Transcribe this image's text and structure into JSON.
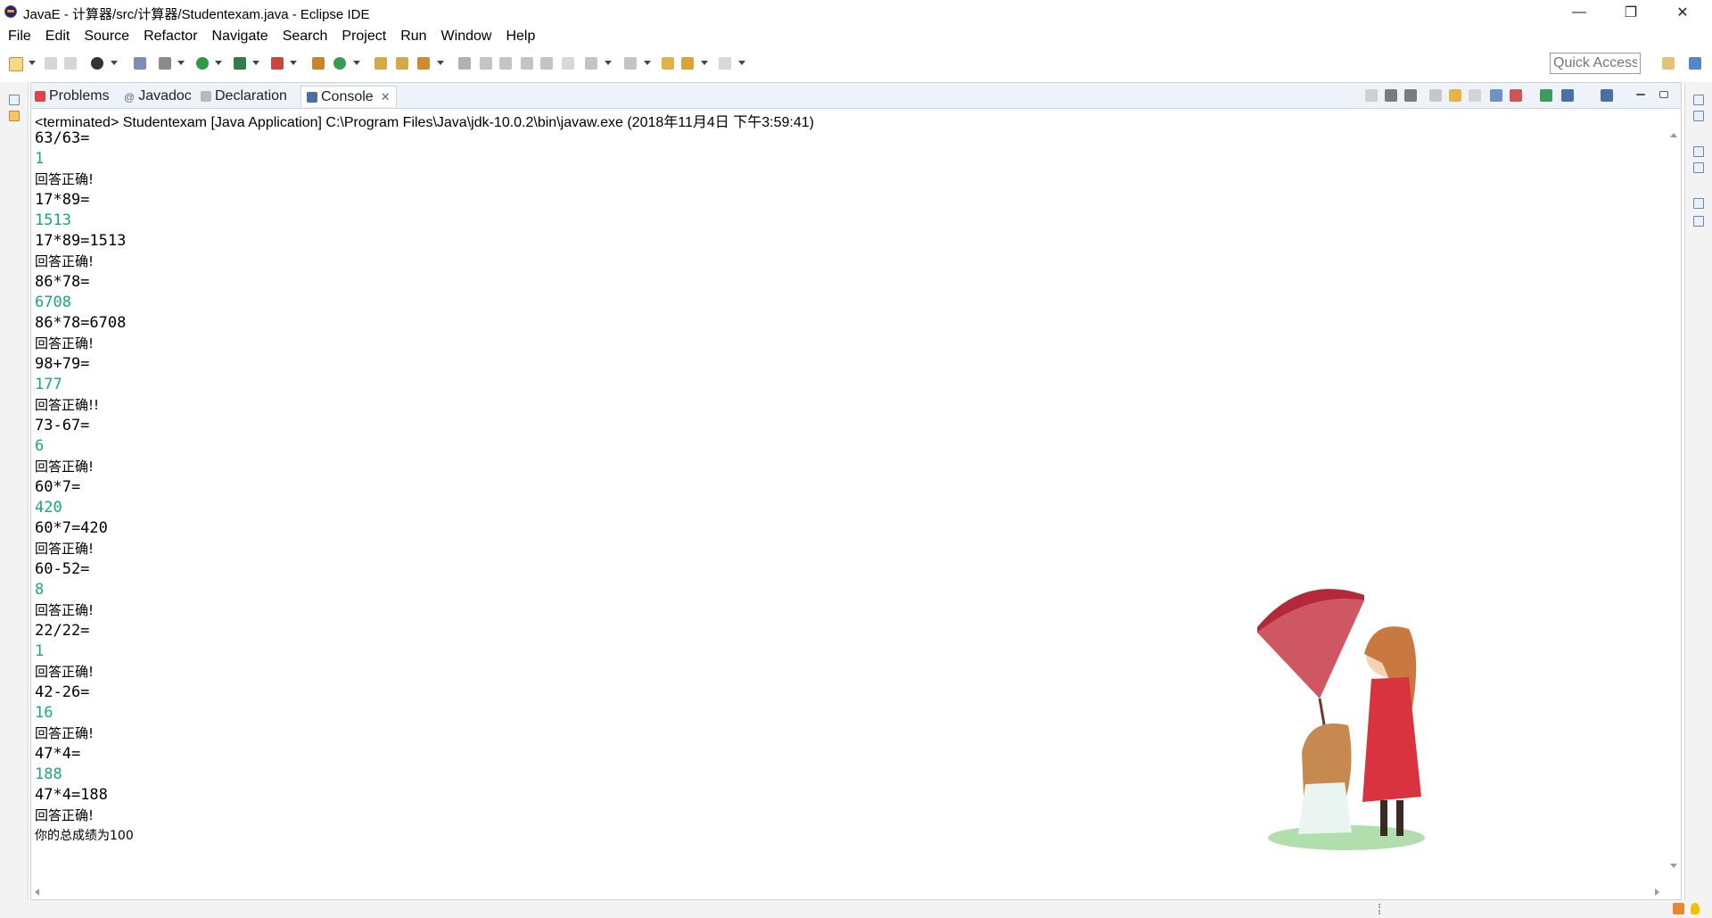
{
  "window": {
    "title": "JavaE - 计算器/src/计算器/Studentexam.java - Eclipse IDE",
    "minimize_glyph": "—",
    "restore_glyph": "❐",
    "close_glyph": "✕"
  },
  "menu": [
    "File",
    "Edit",
    "Source",
    "Refactor",
    "Navigate",
    "Search",
    "Project",
    "Run",
    "Window",
    "Help"
  ],
  "toolbar": {
    "quick_access_placeholder": "Quick Access"
  },
  "tabs": [
    {
      "label": "Problems",
      "icon": "problems-icon"
    },
    {
      "label": "Javadoc",
      "icon": "javadoc-icon"
    },
    {
      "label": "Declaration",
      "icon": "declaration-icon"
    },
    {
      "label": "Console",
      "icon": "console-icon",
      "active": true
    }
  ],
  "tab_close_glyph": "✕",
  "console": {
    "header": "<terminated> Studentexam [Java Application] C:\\Program Files\\Java\\jdk-10.0.2\\bin\\javaw.exe (2018年11月4日 下午3:59:41)",
    "lines": [
      {
        "text": "63/63=",
        "kind": "prompt"
      },
      {
        "text": "1",
        "kind": "input"
      },
      {
        "text": "回答正确!",
        "kind": "msg"
      },
      {
        "text": "17*89=",
        "kind": "prompt"
      },
      {
        "text": "1513",
        "kind": "input"
      },
      {
        "text": "17*89=1513",
        "kind": "prompt"
      },
      {
        "text": "回答正确!",
        "kind": "msg"
      },
      {
        "text": "86*78=",
        "kind": "prompt"
      },
      {
        "text": "6708",
        "kind": "input"
      },
      {
        "text": "86*78=6708",
        "kind": "prompt"
      },
      {
        "text": "回答正确!",
        "kind": "msg"
      },
      {
        "text": "98+79=",
        "kind": "prompt"
      },
      {
        "text": "177",
        "kind": "input"
      },
      {
        "text": "回答正确!!",
        "kind": "msg"
      },
      {
        "text": "73-67=",
        "kind": "prompt"
      },
      {
        "text": "6",
        "kind": "input"
      },
      {
        "text": "回答正确!",
        "kind": "msg"
      },
      {
        "text": "60*7=",
        "kind": "prompt"
      },
      {
        "text": "420",
        "kind": "input"
      },
      {
        "text": "60*7=420",
        "kind": "prompt"
      },
      {
        "text": "回答正确!",
        "kind": "msg"
      },
      {
        "text": "60-52=",
        "kind": "prompt"
      },
      {
        "text": "8",
        "kind": "input"
      },
      {
        "text": "回答正确!",
        "kind": "msg"
      },
      {
        "text": "22/22=",
        "kind": "prompt"
      },
      {
        "text": "1",
        "kind": "input"
      },
      {
        "text": "回答正确!",
        "kind": "msg"
      },
      {
        "text": "42-26=",
        "kind": "prompt"
      },
      {
        "text": "16",
        "kind": "input"
      },
      {
        "text": "回答正确!",
        "kind": "msg"
      },
      {
        "text": "47*4=",
        "kind": "prompt"
      },
      {
        "text": "188",
        "kind": "input"
      },
      {
        "text": "47*4=188",
        "kind": "prompt"
      },
      {
        "text": "回答正确!",
        "kind": "msg"
      },
      {
        "text": "你的总成绩为100",
        "kind": "score"
      }
    ]
  },
  "colors": {
    "input_text": "#16a87c",
    "tab_bar": "#eef3fa"
  }
}
